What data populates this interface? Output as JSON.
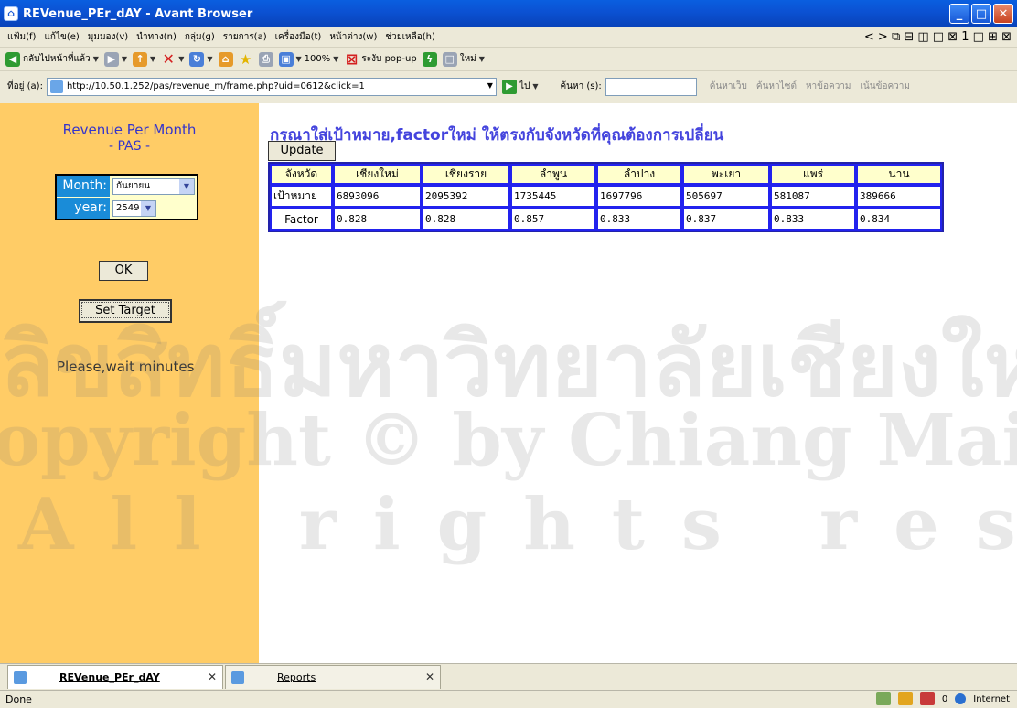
{
  "window": {
    "title": "REVenue_PEr_dAY - Avant Browser",
    "controls": {
      "minimize": "_",
      "maximize": "□",
      "close": "✕"
    }
  },
  "menu": {
    "items": [
      "แฟ้ม(f)",
      "แก้ไข(e)",
      "มุมมอง(v)",
      "นำทาง(n)",
      "กลุ่ม(g)",
      "รายการ(a)",
      "เครื่องมือ(t)",
      "หน้าต่าง(w)",
      "ช่วยเหลือ(h)"
    ],
    "right_glyphs": "< > ⧉ ⊟ ◫ □ ⊠ 1 □ ⊞ ⊠"
  },
  "toolbar": {
    "back": "กลับไปหน้าที่แล้ว",
    "zoom": "100%",
    "popup": "ระงับ pop-up",
    "new": "ใหม่"
  },
  "address": {
    "label": "ที่อยู่ (a):",
    "url": "http://10.50.1.252/pas/revenue_m/frame.php?uid=0612&click=1",
    "go": "ไป",
    "search_label": "ค้นหา (s):",
    "search_options": [
      "ค้นหาเว็บ",
      "ค้นหาไซต์",
      "หาข้อความ",
      "เน้นข้อความ"
    ]
  },
  "left_panel": {
    "title": "Revenue Per Month",
    "subtitle": "- PAS -",
    "month_label": "Month:",
    "month_value": "กันยายน",
    "year_label": "year:",
    "year_value": "2549",
    "ok_label": "OK",
    "set_target_label": "Set Target",
    "wait_message": "Please,wait minutes"
  },
  "main": {
    "heading": "กรุณาใส่เป้าหมาย,factorใหม่ ให้ตรงกับจังหวัดที่คุณต้องการเปลี่ยน",
    "update_label": "Update",
    "table": {
      "header_label": "จังหวัด",
      "provinces": [
        "เชียงใหม่",
        "เชียงราย",
        "ลำพูน",
        "ลำปาง",
        "พะเยา",
        "แพร่",
        "น่าน"
      ],
      "rows": [
        {
          "label": "เป้าหมาย",
          "values": [
            "6893096",
            "2095392",
            "1735445",
            "1697796",
            "505697",
            "581087",
            "389666"
          ]
        },
        {
          "label": "Factor",
          "values": [
            "0.828",
            "0.828",
            "0.857",
            "0.833",
            "0.837",
            "0.833",
            "0.834"
          ]
        }
      ]
    }
  },
  "watermark": {
    "line1": "ลิขสิทธิ์มหาวิทยาลัยเชียงใหม่",
    "line2": "Copyright © by Chiang Mai University",
    "line3": "All rights reserved"
  },
  "tabs": [
    {
      "label": "REVenue_PEr_dAY",
      "active": true
    },
    {
      "label": "Reports",
      "active": false
    }
  ],
  "status": {
    "text": "Done",
    "count": "0",
    "zone": "Internet"
  }
}
